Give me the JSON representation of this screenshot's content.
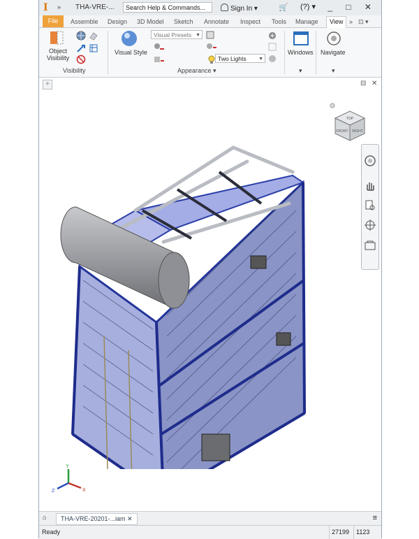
{
  "titlebar": {
    "quick_access": "»",
    "document": "THA-VRE-...",
    "search_placeholder": "Search Help & Commands...",
    "sign_in": "Sign In",
    "cart": "🛒",
    "help": "?",
    "window_controls": "_ □ ✕"
  },
  "ribbon_tabs": [
    "File",
    "Assemble",
    "Design",
    "3D Model",
    "Sketch",
    "Annotate",
    "Inspect",
    "Tools",
    "Manage",
    "View"
  ],
  "ribbon_tab_overflow": "»",
  "ribbon": {
    "object_visibility": "Object\nVisibility",
    "visibility_group": "Visibility",
    "visual_style": "Visual Style",
    "visual_presets": "Visual Presets",
    "lighting": "Two Lights",
    "appearance_group": "Appearance ▾",
    "windows": "Windows",
    "navigate": "Navigate"
  },
  "viewcube": {
    "top": "TOP",
    "front": "FRONT",
    "right": "RIGHT"
  },
  "doc_tab": "THA-VRE-20201-...iam",
  "status": {
    "ready": "Ready",
    "count1": "27199",
    "count2": "1123"
  },
  "colors": {
    "accent_file_tab": "#f0a23a",
    "model_frame": "#2b3fa8",
    "model_fill": "#6877d4"
  }
}
